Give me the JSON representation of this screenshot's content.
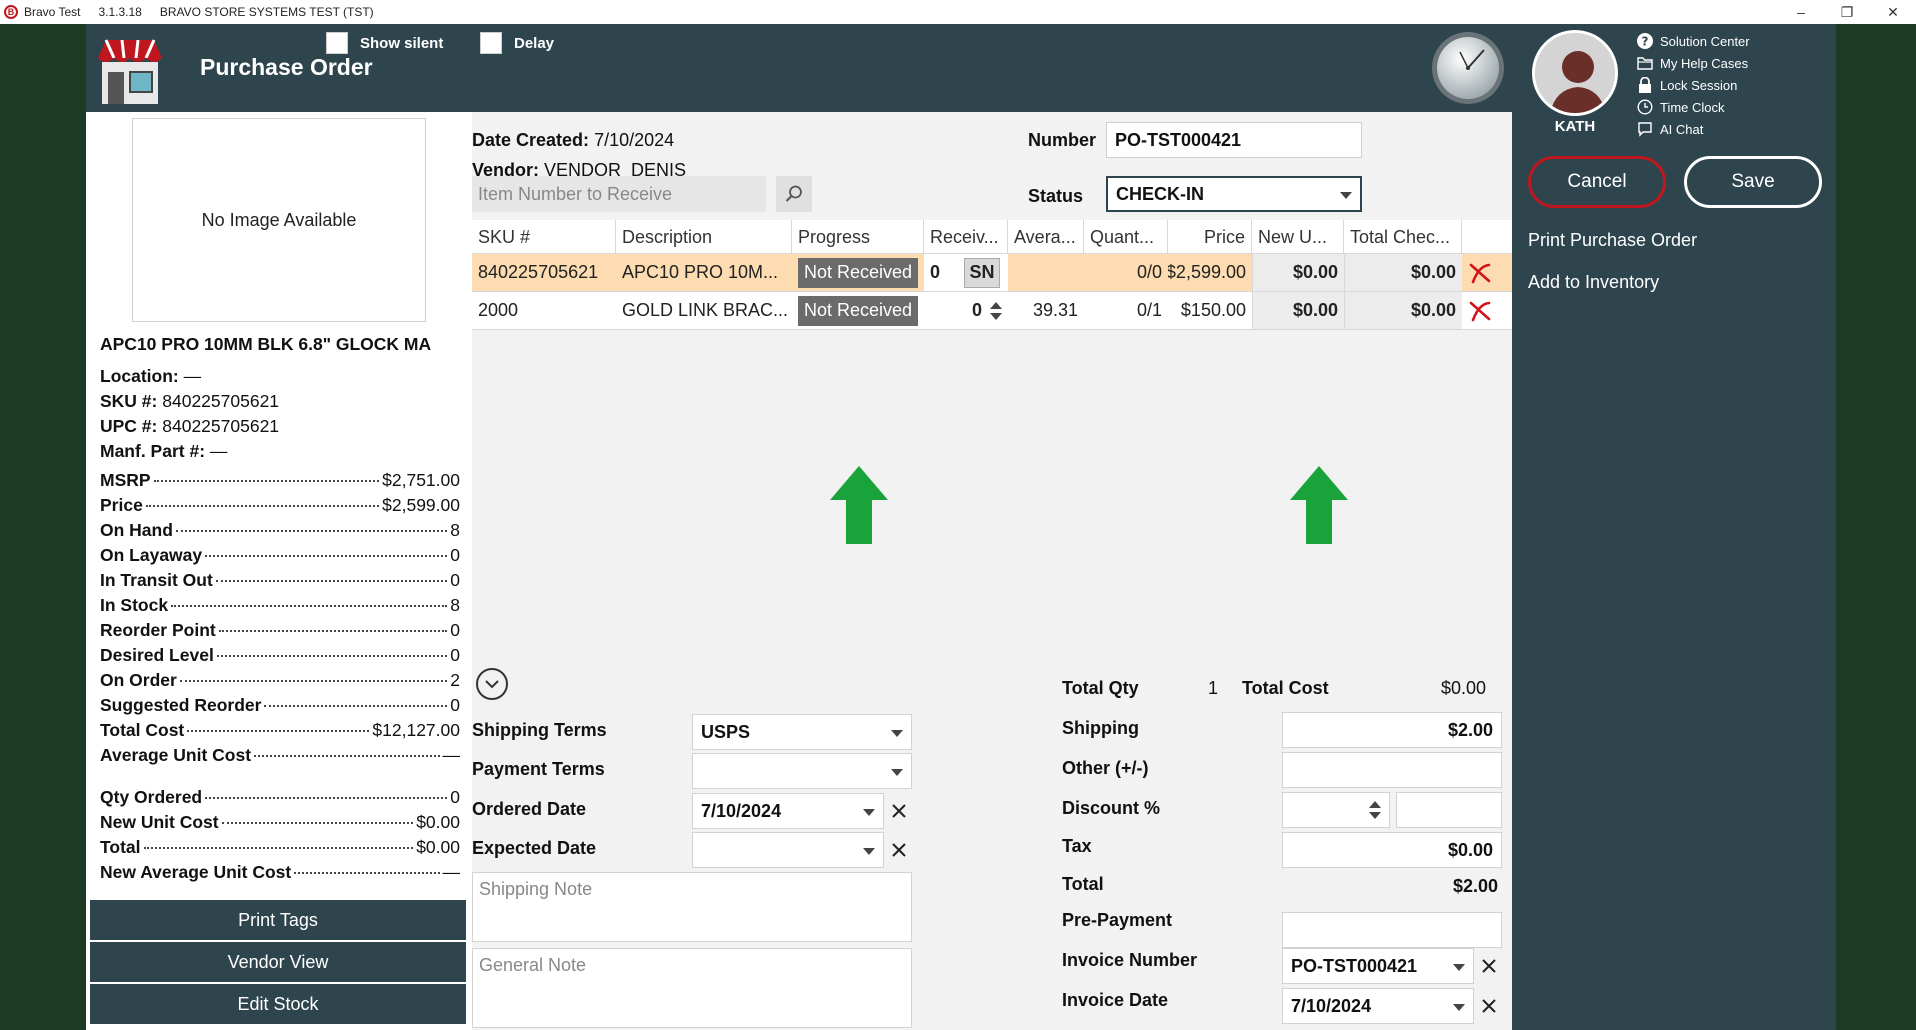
{
  "titlebar": {
    "app_name": "Bravo Test",
    "version": "3.1.3.18",
    "env": "BRAVO STORE SYSTEMS TEST (TST)"
  },
  "header": {
    "title": "Purchase Order",
    "show_silent_label": "Show silent",
    "delay_label": "Delay"
  },
  "user": {
    "name": "KATH"
  },
  "quick_links": [
    {
      "label": "Solution Center",
      "icon": "question-icon"
    },
    {
      "label": "My Help Cases",
      "icon": "folder-icon"
    },
    {
      "label": "Lock Session",
      "icon": "lock-icon"
    },
    {
      "label": "Time Clock",
      "icon": "clock-icon"
    },
    {
      "label": "AI Chat",
      "icon": "chat-icon"
    }
  ],
  "actions": {
    "cancel": "Cancel",
    "save": "Save",
    "print_po": "Print Purchase Order",
    "add_inventory": "Add to Inventory"
  },
  "product": {
    "no_image": "No Image Available",
    "name": "APC10 PRO 10MM BLK 6.8\" GLOCK MA",
    "location_label": "Location:",
    "location": "—",
    "sku_label": "SKU #:",
    "sku": "840225705621",
    "upc_label": "UPC #:",
    "upc": "840225705621",
    "manf_label": "Manf. Part #:",
    "manf": "—"
  },
  "stats": [
    {
      "label": "MSRP",
      "value": "$2,751.00"
    },
    {
      "label": "Price",
      "value": "$2,599.00"
    },
    {
      "label": "On Hand",
      "value": "8"
    },
    {
      "label": "On Layaway",
      "value": "0"
    },
    {
      "label": "In Transit Out",
      "value": "0"
    },
    {
      "label": "In Stock",
      "value": "8"
    },
    {
      "label": "Reorder Point",
      "value": "0"
    },
    {
      "label": "Desired Level",
      "value": "0"
    },
    {
      "label": "On Order",
      "value": "2"
    },
    {
      "label": "Suggested Reorder",
      "value": "0"
    },
    {
      "label": "Total Cost",
      "value": "$12,127.00"
    },
    {
      "label": "Average Unit Cost",
      "value": "—"
    }
  ],
  "stats2": [
    {
      "label": "Qty Ordered",
      "value": "0"
    },
    {
      "label": "New Unit Cost",
      "value": "$0.00"
    },
    {
      "label": "Total",
      "value": "$0.00"
    },
    {
      "label": "New Average Unit Cost",
      "value": "—"
    }
  ],
  "left_buttons": {
    "print_tags": "Print Tags",
    "vendor_view": "Vendor View",
    "edit_stock": "Edit Stock"
  },
  "po": {
    "date_created_label": "Date Created:",
    "date_created": "7/10/2024",
    "vendor_label": "Vendor:",
    "vendor": "VENDOR_DENIS",
    "number_label": "Number",
    "number": "PO-TST000421",
    "status_label": "Status",
    "status": "CHECK-IN",
    "search_placeholder": "Item Number to Receive"
  },
  "grid": {
    "columns": [
      "SKU #",
      "Description",
      "Progress",
      "Receiv...",
      "Avera...",
      "Quant...",
      "Price",
      "New U...",
      "Total Chec..."
    ],
    "rows": [
      {
        "sku": "840225705621",
        "description": "APC10 PRO 10M...",
        "progress": "Not Received",
        "received": "0",
        "sn": "SN",
        "average": "",
        "quantity": "0/0",
        "price": "$2,599.00",
        "new_unit": "$0.00",
        "total_checked": "$0.00"
      },
      {
        "sku": "2000",
        "description": "GOLD LINK BRAC...",
        "progress": "Not Received",
        "received": "0",
        "sn": "",
        "average": "39.31",
        "quantity": "0/1",
        "price": "$150.00",
        "new_unit": "$0.00",
        "total_checked": "$0.00"
      }
    ]
  },
  "form": {
    "shipping_terms_label": "Shipping Terms",
    "shipping_terms": "USPS",
    "payment_terms_label": "Payment Terms",
    "payment_terms": "",
    "ordered_date_label": "Ordered Date",
    "ordered_date": "7/10/2024",
    "expected_date_label": "Expected Date",
    "expected_date": "",
    "shipping_note_placeholder": "Shipping Note",
    "general_note_placeholder": "General Note"
  },
  "totals": {
    "total_qty_label": "Total Qty",
    "total_qty": "1",
    "total_cost_label": "Total Cost",
    "total_cost": "$0.00",
    "shipping_label": "Shipping",
    "shipping": "$2.00",
    "other_label": "Other (+/-)",
    "other": "",
    "discount_label": "Discount %",
    "discount": "",
    "tax_label": "Tax",
    "tax": "$0.00",
    "total_label": "Total",
    "total": "$2.00",
    "prepayment_label": "Pre-Payment",
    "prepayment": "",
    "invoice_number_label": "Invoice Number",
    "invoice_number": "PO-TST000421",
    "invoice_date_label": "Invoice Date",
    "invoice_date": "7/10/2024"
  },
  "colors": {
    "accent": "#2e454e",
    "highlight_row": "#fcdcb0",
    "danger": "#c0171e",
    "arrow": "#1aa33a"
  }
}
